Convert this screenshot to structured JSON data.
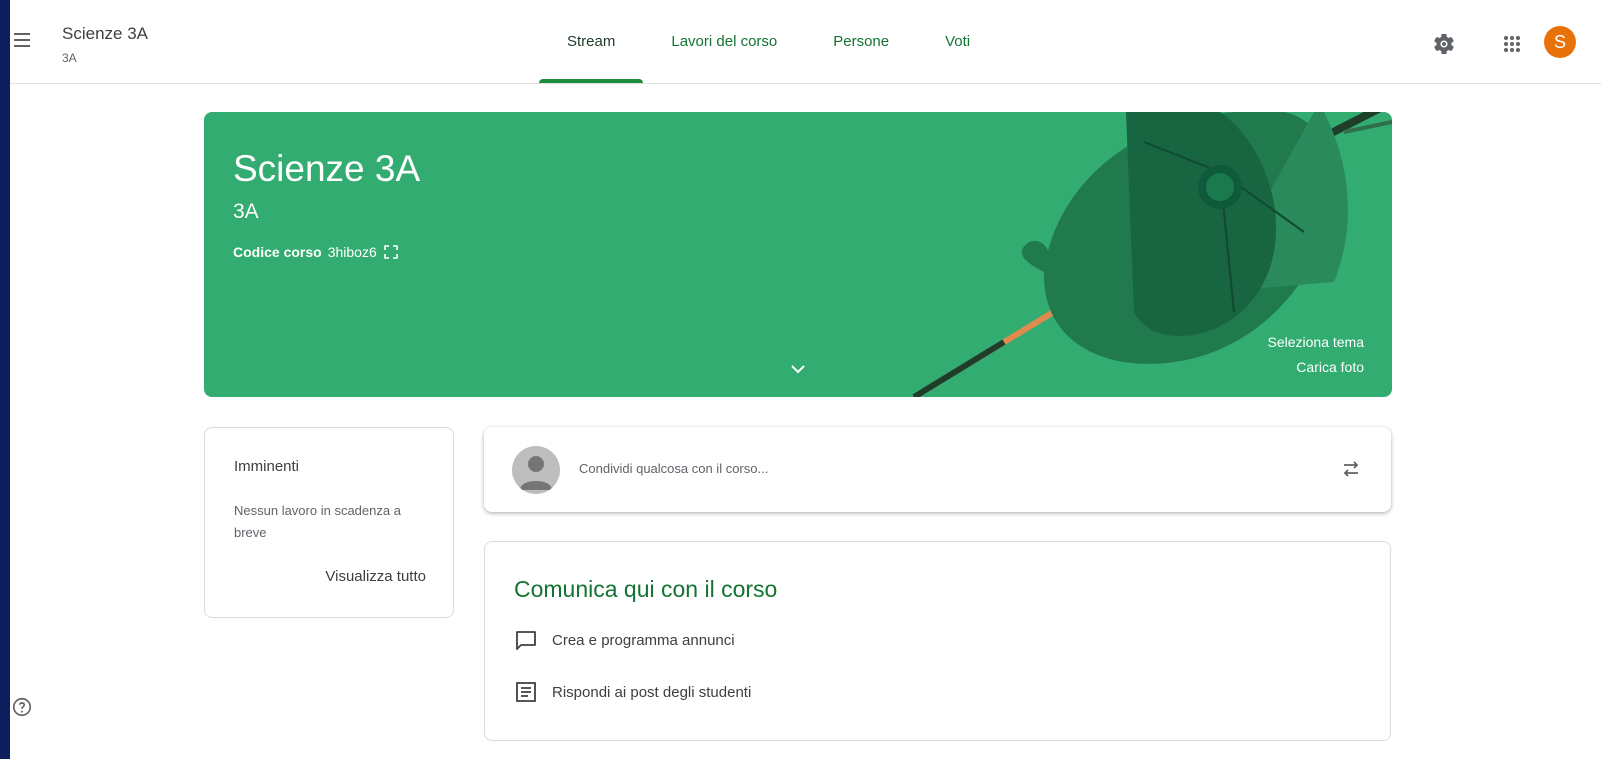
{
  "header": {
    "class_title": "Scienze 3A",
    "class_section": "3A",
    "tabs": [
      {
        "label": "Stream",
        "active": true
      },
      {
        "label": "Lavori del corso",
        "active": false
      },
      {
        "label": "Persone",
        "active": false
      },
      {
        "label": "Voti",
        "active": false
      }
    ],
    "avatar_letter": "S",
    "avatar_color": "#e8710a",
    "icons": [
      "menu-icon",
      "gear-icon",
      "apps-grid-icon"
    ]
  },
  "banner": {
    "title": "Scienze 3A",
    "section": "3A",
    "code_label": "Codice corso",
    "code_value": "3hiboz6",
    "select_theme": "Seleziona tema",
    "upload_photo": "Carica foto",
    "color": "#33ac71"
  },
  "upcoming": {
    "title": "Imminenti",
    "empty_text": "Nessun lavoro in scadenza a breve",
    "view_all": "Visualizza tutto"
  },
  "share": {
    "placeholder": "Condividi qualcosa con il corso..."
  },
  "communicate": {
    "title": "Comunica qui con il corso",
    "items": [
      {
        "label": "Crea e programma annunci",
        "icon": "chat-bubble-icon"
      },
      {
        "label": "Rispondi ai post degli studenti",
        "icon": "message-lines-icon"
      }
    ]
  },
  "theme": {
    "accent_green": "#137333",
    "indicator_green": "#1e8e3e",
    "outer_background": "#0d1e5c"
  }
}
